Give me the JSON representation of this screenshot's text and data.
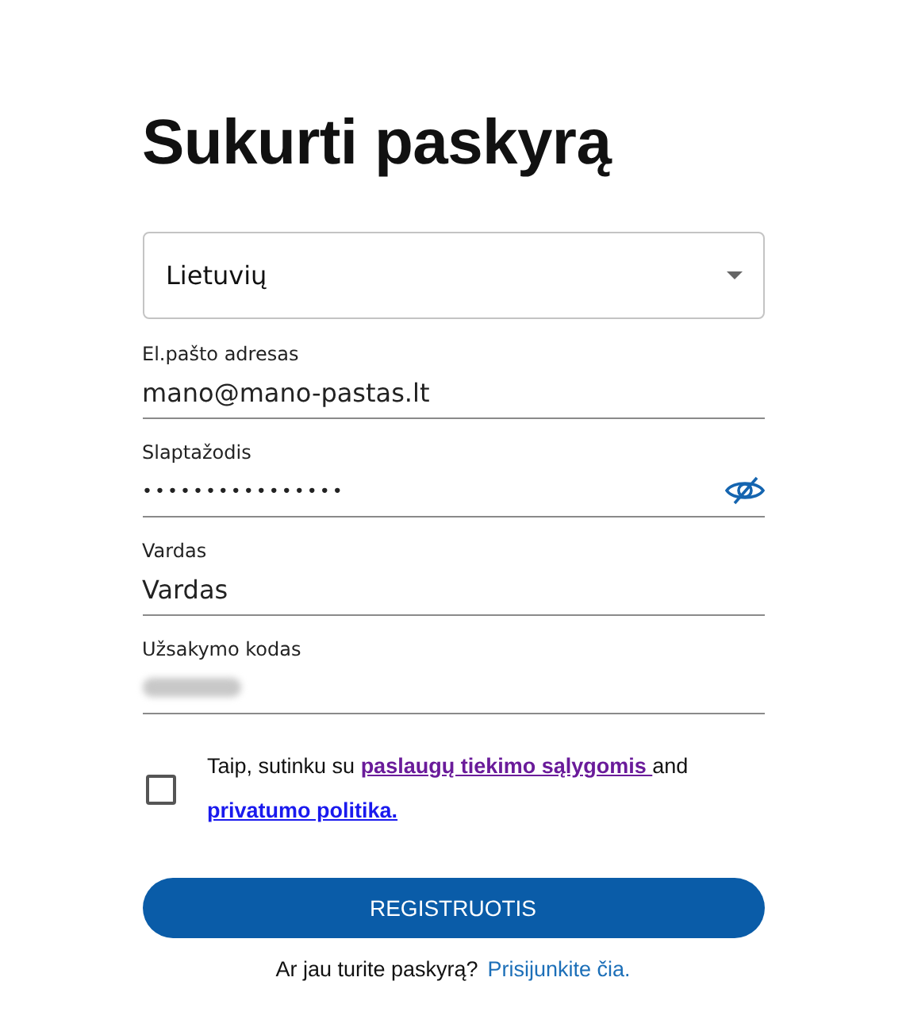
{
  "title": "Sukurti paskyrą",
  "language_select": {
    "value": "Lietuvių"
  },
  "fields": [
    {
      "kind": "text",
      "label": "El.pašto adresas",
      "value": "mano@mano-pastas.lt",
      "blurred": false
    },
    {
      "kind": "password",
      "label": "Slaptažodis",
      "value": "••••••••••••••••",
      "blurred": false
    },
    {
      "kind": "text",
      "label": "Vardas",
      "value": "Vardas",
      "blurred": false
    },
    {
      "kind": "text",
      "label": "Užsakymo kodas",
      "blurred": true
    }
  ],
  "consent": {
    "checked": false,
    "text": "Taip, sutinku su ",
    "link_1": "paslaugų tiekimo sąlygomis ",
    "middle": "and",
    "link_2": "privatumo politika."
  },
  "register_button": "REGISTRUOTIS",
  "footer": {
    "text": "Ar jau turite paskyrą?",
    "link": "Prisijunkite čia."
  }
}
